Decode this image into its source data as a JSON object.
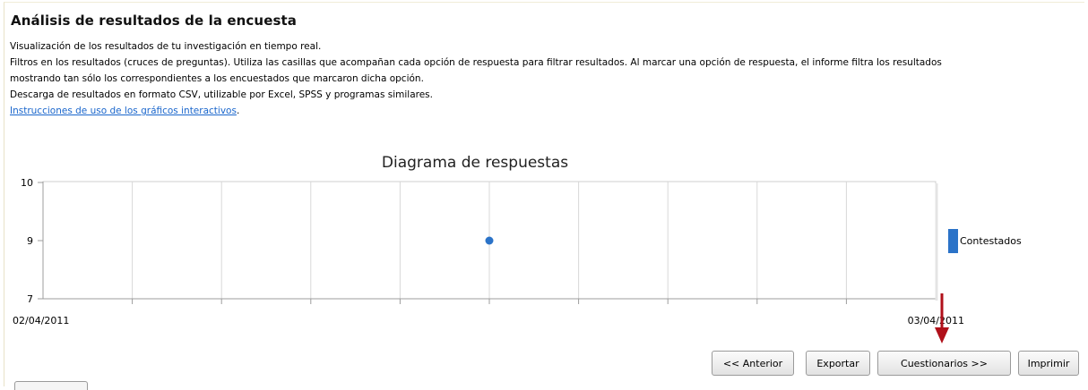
{
  "page": {
    "title": "Análisis de resultados de la encuesta",
    "lines": [
      "Visualización de los resultados de tu investigación en tiempo real.",
      "Filtros en los resultados (cruces de preguntas). Utiliza las casillas que acompañan cada opción de respuesta para filtrar resultados. Al marcar una opción de respuesta, el informe filtra los resultados",
      "mostrando tan sólo los correspondientes a los encuestados que marcaron dicha opción.",
      "Descarga de resultados en formato CSV, utilizable por Excel, SPSS y programas similares."
    ],
    "link_text": "Instrucciones de uso de los gráficos interactivos",
    "link_suffix": "."
  },
  "chart_data": {
    "type": "scatter",
    "title": "Diagrama de respuestas",
    "ytick_labels": [
      "10",
      "9",
      "7"
    ],
    "xtick_labels": [
      "02/04/2011",
      "03/04/2011"
    ],
    "x_range": [
      "2011-04-02",
      "2011-04-03"
    ],
    "series": [
      {
        "name": "Contestados",
        "color": "#2b73c8",
        "points": [
          {
            "x": "2011-04-02 12:00",
            "y": 9
          }
        ]
      }
    ],
    "grid": true,
    "legend_position": "right"
  },
  "buttons": {
    "previous": "<< Anterior",
    "export": "Exportar",
    "questionnaires": "Cuestionarios >>",
    "print": "Imprimir"
  },
  "colors": {
    "accent": "#2b73c8",
    "link": "#1a66cc",
    "arrow": "#b0101a"
  },
  "icons": {
    "annotation": "red-arrow-down"
  }
}
